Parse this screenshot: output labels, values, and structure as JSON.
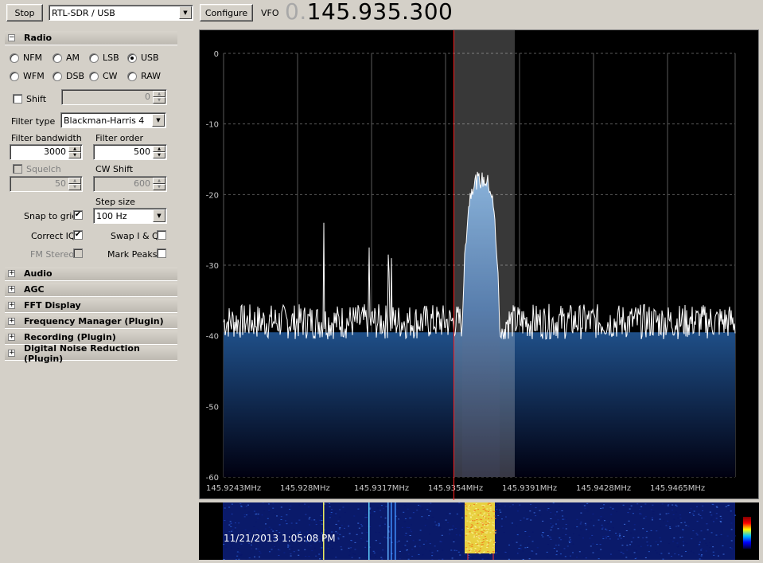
{
  "toolbar": {
    "stop_label": "Stop",
    "source": "RTL-SDR / USB",
    "configure_label": "Configure",
    "vfo_label": "VFO",
    "vfo_prefix": "0.",
    "vfo_value": "145.935.300"
  },
  "sections": {
    "radio": "Radio",
    "audio": "Audio",
    "agc": "AGC",
    "fft": "FFT Display",
    "freq_manager": "Frequency Manager (Plugin)",
    "recording": "Recording (Plugin)",
    "dnr": "Digital Noise Reduction (Plugin)"
  },
  "radio": {
    "modes": [
      "NFM",
      "AM",
      "LSB",
      "USB",
      "WFM",
      "DSB",
      "CW",
      "RAW"
    ],
    "selected_mode": "USB",
    "shift_label": "Shift",
    "shift_value": "0",
    "filter_type_label": "Filter type",
    "filter_type": "Blackman-Harris 4",
    "filter_bandwidth_label": "Filter bandwidth",
    "filter_bandwidth": "3000",
    "filter_order_label": "Filter order",
    "filter_order": "500",
    "squelch_label": "Squelch",
    "squelch_value": "50",
    "cw_shift_label": "CW Shift",
    "cw_shift_value": "600",
    "step_size_label": "Step size",
    "step_size": "100 Hz",
    "snap_label": "Snap to grid",
    "snap_checked": true,
    "correct_iq_label": "Correct IQ",
    "correct_iq_checked": true,
    "swap_iq_label": "Swap I & Q",
    "swap_iq_checked": false,
    "fm_stereo_label": "FM Stereo",
    "mark_peaks_label": "Mark Peaks",
    "mark_peaks_checked": false
  },
  "spectrum": {
    "y_ticks": [
      "0",
      "-10",
      "-20",
      "-30",
      "-40",
      "-50",
      "-60"
    ],
    "x_ticks": [
      "145.9243MHz",
      "145.928MHz",
      "145.9317MHz",
      "145.9354MHz",
      "145.9391MHz",
      "145.9428MHz",
      "145.9465MHz"
    ],
    "noise_floor_db": -38,
    "signal_peak_db": -20,
    "colors": {
      "line": "#ffffff",
      "fill_top": "#2a5fa0",
      "fill_bottom": "#000010",
      "vfo_line": "#ff2020",
      "grid": "#5a5a5a"
    }
  },
  "waterfall": {
    "timestamp": "11/21/2013 1:05:08 PM"
  }
}
